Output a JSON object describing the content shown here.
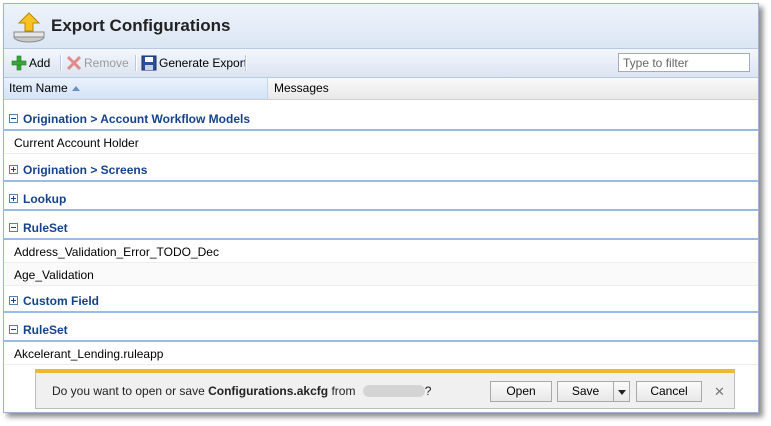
{
  "window": {
    "title": "Export Configurations",
    "icon": "export-upload-icon"
  },
  "toolbar": {
    "add_label": "Add",
    "remove_label": "Remove",
    "generate_label": "Generate Export",
    "filter_placeholder": "Type to filter"
  },
  "columns": {
    "item_name": "Item Name",
    "messages": "Messages"
  },
  "groups": [
    {
      "label": "Origination > Account Workflow Models",
      "expanded": true,
      "items": [
        "Current Account Holder"
      ]
    },
    {
      "label": "Origination > Screens",
      "expanded": false,
      "items": []
    },
    {
      "label": "Lookup",
      "expanded": false,
      "items": []
    },
    {
      "label": "RuleSet",
      "expanded": true,
      "items": [
        "Address_Validation_Error_TODO_Dec",
        "Age_Validation"
      ]
    },
    {
      "label": "Custom Field",
      "expanded": false,
      "items": []
    },
    {
      "label": "RuleSet",
      "expanded": true,
      "items": [
        "Akcelerant_Lending.ruleapp"
      ]
    }
  ],
  "download_bar": {
    "prompt_prefix": "Do you want to open or save ",
    "filename": "Configurations.akcfg",
    "prompt_mid": " from ",
    "prompt_suffix": "?",
    "open_label": "Open",
    "save_label": "Save",
    "cancel_label": "Cancel",
    "close_glyph": "✕"
  },
  "colors": {
    "group_text": "#15428b",
    "group_border": "#99bbe8",
    "download_accent": "#f2b632"
  }
}
